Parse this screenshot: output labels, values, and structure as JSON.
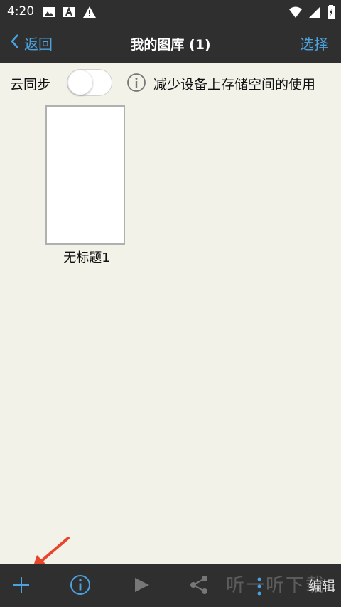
{
  "status": {
    "time": "4:20"
  },
  "nav": {
    "back_label": "返回",
    "title": "我的图库 (1)",
    "select_label": "选择"
  },
  "sync": {
    "label": "云同步",
    "enabled": false,
    "description": "减少设备上存储空间的使用"
  },
  "gallery": {
    "items": [
      {
        "title": "无标题1"
      }
    ]
  },
  "toolbar": {
    "edit_label": "编辑"
  },
  "watermark": "听一听下载",
  "icons": [
    "image-icon",
    "a-icon",
    "warning-icon",
    "wifi-icon",
    "signal-icon",
    "battery-icon",
    "chevron-left-icon",
    "info-icon",
    "add-icon",
    "play-icon",
    "share-icon",
    "more-icon"
  ],
  "colors": {
    "accent": "#4aa3df",
    "bar": "#2f2f2f",
    "background": "#f3f2e8",
    "annotation": "#e8462c"
  }
}
